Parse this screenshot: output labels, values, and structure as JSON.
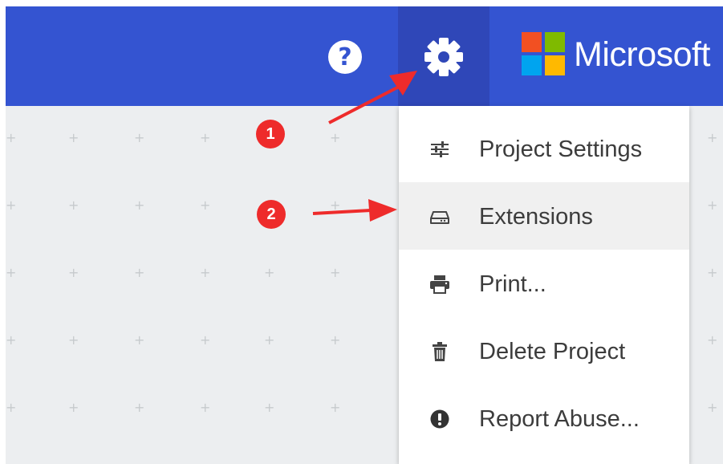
{
  "header": {
    "help_icon": "question-circle-icon",
    "help_glyph": "?",
    "settings_icon": "gear-icon",
    "brand": {
      "logo": "microsoft-logo",
      "logo_colors": [
        "#f25022",
        "#7fba00",
        "#00a4ef",
        "#ffb900"
      ],
      "name": "Microsoft"
    },
    "background_color": "#3454d1",
    "active_button_color": "#2f47b8"
  },
  "menu": {
    "items": [
      {
        "label": "Project Settings",
        "icon": "sliders-icon"
      },
      {
        "label": "Extensions",
        "icon": "drive-icon",
        "highlighted": true
      },
      {
        "label": "Print...",
        "icon": "printer-icon"
      },
      {
        "label": "Delete Project",
        "icon": "trash-icon"
      },
      {
        "label": "Report Abuse...",
        "icon": "exclamation-circle-icon"
      }
    ]
  },
  "annotations": {
    "step1": "1",
    "step2": "2",
    "color": "#ee2b2b"
  }
}
